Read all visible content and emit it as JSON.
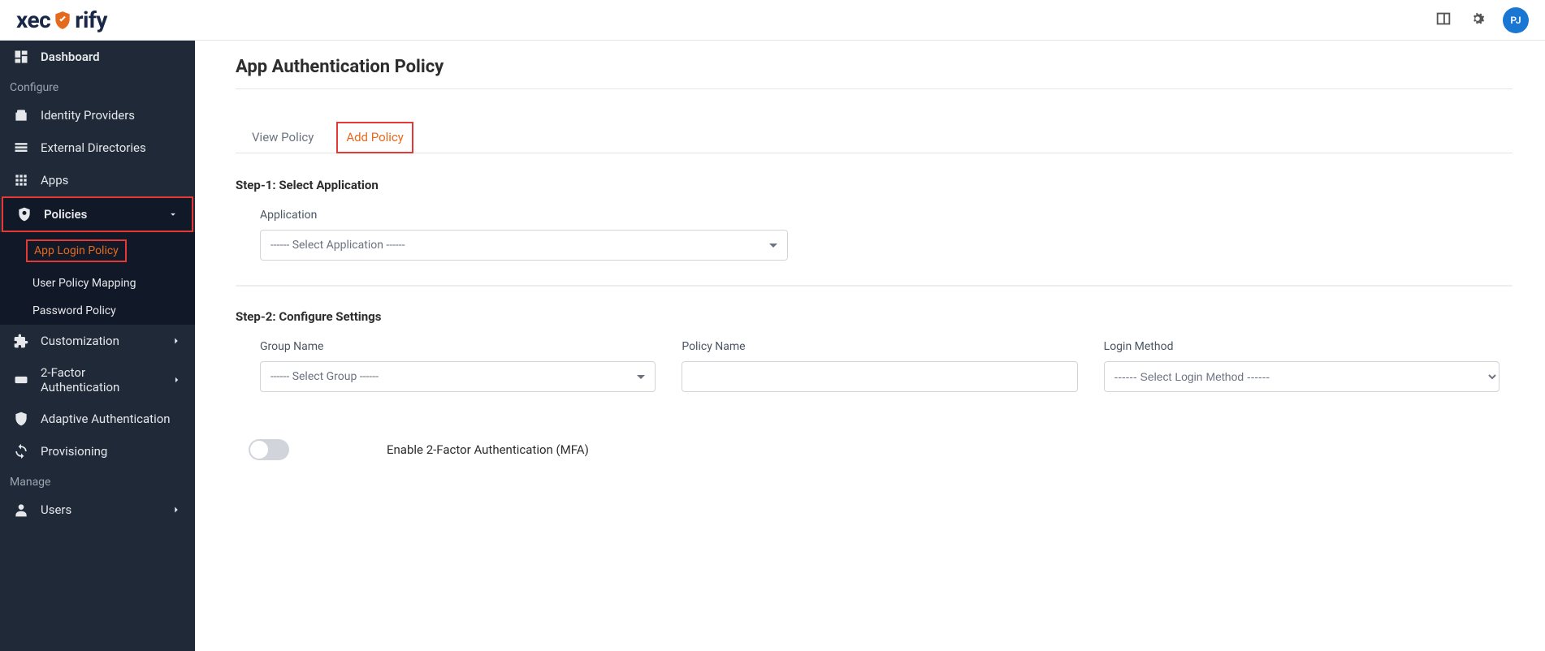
{
  "brand": {
    "prefix": "xec",
    "suffix": "rify"
  },
  "header": {
    "avatar_initials": "PJ"
  },
  "sidebar": {
    "dashboard": "Dashboard",
    "section_configure": "Configure",
    "identity_providers": "Identity Providers",
    "external_directories": "External Directories",
    "apps": "Apps",
    "policies": "Policies",
    "policies_sub": {
      "app_login": "App Login Policy",
      "user_policy": "User Policy Mapping",
      "password_policy": "Password Policy"
    },
    "customization": "Customization",
    "two_factor": "2-Factor Authentication",
    "adaptive_auth": "Adaptive Authentication",
    "provisioning": "Provisioning",
    "section_manage": "Manage",
    "users": "Users"
  },
  "page": {
    "title": "App Authentication Policy",
    "tabs": {
      "view": "View Policy",
      "add": "Add Policy"
    },
    "step1": {
      "title": "Step-1: Select Application",
      "application_label": "Application",
      "application_placeholder": "------ Select Application ------"
    },
    "step2": {
      "title": "Step-2: Configure Settings",
      "group_label": "Group Name",
      "group_placeholder": "------ Select Group ------",
      "policy_label": "Policy Name",
      "login_method_label": "Login Method",
      "login_method_placeholder": "------ Select Login Method ------",
      "mfa_label": "Enable 2-Factor Authentication (MFA)"
    }
  }
}
